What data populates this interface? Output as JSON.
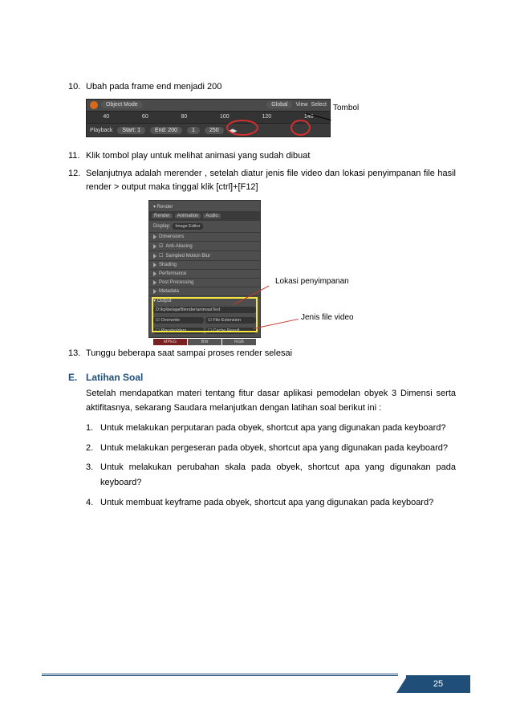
{
  "steps": {
    "s10": {
      "num": "10.",
      "text": "Ubah pada frame end menjadi 200"
    },
    "s11": {
      "num": "11.",
      "text": "Klik tombol play untuk melihat animasi yang sudah dibuat"
    },
    "s12": {
      "num": "12.",
      "text": "Selanjutnya adalah merender , setelah diatur jenis file video dan lokasi penyimpanan file hasil render > output maka tinggal klik [ctrl]+[F12]"
    },
    "s13": {
      "num": "13.",
      "text": "Tunggu beberapa saat sampai proses render selesai"
    }
  },
  "timeline": {
    "mode": "Object Mode",
    "global": "Global",
    "view": "View",
    "select": "Select",
    "ticks": [
      "40",
      "60",
      "80",
      "100",
      "120",
      "140"
    ],
    "playback": "Playback",
    "start_lbl": "Start:",
    "start_val": "1",
    "end_lbl": "End:",
    "end_val": "200",
    "cur": "1",
    "last": "250",
    "label_tombol": "Tombol"
  },
  "render": {
    "tabs": {
      "render": "Render",
      "anim": "Animation",
      "audio": "Audio"
    },
    "display": "Display:",
    "display_val": "Image Editor",
    "rows": [
      "Dimensions",
      "Anti-Aliasing",
      "Sampled Motion Blur",
      "Shading",
      "Performance",
      "Post Processing",
      "Metadata",
      "Output"
    ],
    "output_path": "D:\\kp\\belajarBlender\\animasiText",
    "overwrite": "Overwrite",
    "file_ext": "File Extension",
    "placeholder": "Placeholders",
    "cache": "Cache Result",
    "mpeg": "MPEG",
    "bw": "BW",
    "rgb": "RGB",
    "anno_lokasi": "Lokasi penyimpanan",
    "anno_jenis": "Jenis file video"
  },
  "section": {
    "letter": "E.",
    "title": "Latihan Soal",
    "intro": "Setelah mendapatkan materi tentang fitur dasar aplikasi pemodelan obyek 3 Dimensi serta aktifitasnya, sekarang Saudara melanjutkan dengan latihan soal berikut ini :",
    "q1": {
      "num": "1.",
      "text": "Untuk melakukan perputaran pada obyek, shortcut apa yang digunakan pada keyboard?"
    },
    "q2": {
      "num": "2.",
      "text": "Untuk melakukan pergeseran pada obyek, shortcut apa yang digunakan pada keyboard?"
    },
    "q3": {
      "num": "3.",
      "text": "Untuk melakukan perubahan skala pada obyek, shortcut apa yang digunakan pada keyboard?"
    },
    "q4": {
      "num": "4.",
      "text": "Untuk membuat keyframe pada obyek, shortcut apa yang digunakan pada keyboard?"
    }
  },
  "page_number": "25"
}
